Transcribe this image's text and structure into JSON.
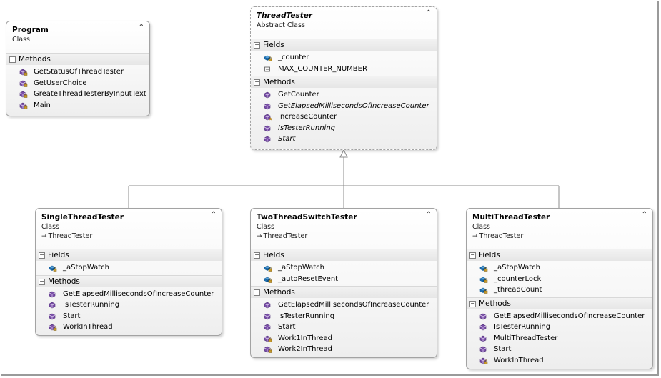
{
  "classes": {
    "program": {
      "name": "Program",
      "kind": "Class",
      "sections": {
        "methods": {
          "title": "Methods",
          "items": [
            {
              "label": "GetStatusOfThreadTester",
              "icon": "private-method-icon"
            },
            {
              "label": "GetUserChoice",
              "icon": "private-method-icon"
            },
            {
              "label": "GreateThreadTesterByInputText",
              "icon": "private-method-icon"
            },
            {
              "label": "Main",
              "icon": "private-method-icon"
            }
          ]
        }
      }
    },
    "thread_tester": {
      "name": "ThreadTester",
      "kind": "Abstract Class",
      "sections": {
        "fields": {
          "title": "Fields",
          "items": [
            {
              "label": "_counter",
              "icon": "private-field-icon"
            },
            {
              "label": "MAX_COUNTER_NUMBER",
              "icon": "constant-icon"
            }
          ]
        },
        "methods": {
          "title": "Methods",
          "items": [
            {
              "label": "GetCounter",
              "icon": "method-icon",
              "italic": false
            },
            {
              "label": "GetElapsedMillisecondsOfIncreaseCounter",
              "icon": "method-icon",
              "italic": true
            },
            {
              "label": "IncreaseCounter",
              "icon": "protected-method-icon",
              "italic": false
            },
            {
              "label": "IsTesterRunning",
              "icon": "method-icon",
              "italic": true
            },
            {
              "label": "Start",
              "icon": "method-icon",
              "italic": true
            }
          ]
        }
      }
    },
    "single_thread_tester": {
      "name": "SingleThreadTester",
      "kind": "Class",
      "parent": "ThreadTester",
      "sections": {
        "fields": {
          "title": "Fields",
          "items": [
            {
              "label": "_aStopWatch",
              "icon": "private-field-icon"
            }
          ]
        },
        "methods": {
          "title": "Methods",
          "items": [
            {
              "label": "GetElapsedMillisecondsOfIncreaseCounter",
              "icon": "method-icon"
            },
            {
              "label": "IsTesterRunning",
              "icon": "method-icon"
            },
            {
              "label": "Start",
              "icon": "method-icon"
            },
            {
              "label": "WorkInThread",
              "icon": "private-method-icon"
            }
          ]
        }
      }
    },
    "two_thread_switch_tester": {
      "name": "TwoThreadSwitchTester",
      "kind": "Class",
      "parent": "ThreadTester",
      "sections": {
        "fields": {
          "title": "Fields",
          "items": [
            {
              "label": "_aStopWatch",
              "icon": "private-field-icon"
            },
            {
              "label": "_autoResetEvent",
              "icon": "private-field-icon"
            }
          ]
        },
        "methods": {
          "title": "Methods",
          "items": [
            {
              "label": "GetElapsedMillisecondsOfIncreaseCounter",
              "icon": "method-icon"
            },
            {
              "label": "IsTesterRunning",
              "icon": "method-icon"
            },
            {
              "label": "Start",
              "icon": "method-icon"
            },
            {
              "label": "Work1InThread",
              "icon": "private-method-icon"
            },
            {
              "label": "Work2InThread",
              "icon": "private-method-icon"
            }
          ]
        }
      }
    },
    "multi_thread_tester": {
      "name": "MultiThreadTester",
      "kind": "Class",
      "parent": "ThreadTester",
      "sections": {
        "fields": {
          "title": "Fields",
          "items": [
            {
              "label": "_aStopWatch",
              "icon": "private-field-icon"
            },
            {
              "label": "_counterLock",
              "icon": "private-field-icon"
            },
            {
              "label": "_threadCount",
              "icon": "private-field-icon"
            }
          ]
        },
        "methods": {
          "title": "Methods",
          "items": [
            {
              "label": "GetElapsedMillisecondsOfIncreaseCounter",
              "icon": "method-icon"
            },
            {
              "label": "IsTesterRunning",
              "icon": "method-icon"
            },
            {
              "label": "MultiThreadTester",
              "icon": "method-icon"
            },
            {
              "label": "Start",
              "icon": "method-icon"
            },
            {
              "label": "WorkInThread",
              "icon": "private-method-icon"
            }
          ]
        }
      }
    }
  },
  "colors": {
    "method_icon": "#7a4fa8",
    "field_icon": "#1e73b8",
    "constant_icon": "#555555",
    "lock_icon": "#c79a2a",
    "connector": "#8c8c8c"
  }
}
